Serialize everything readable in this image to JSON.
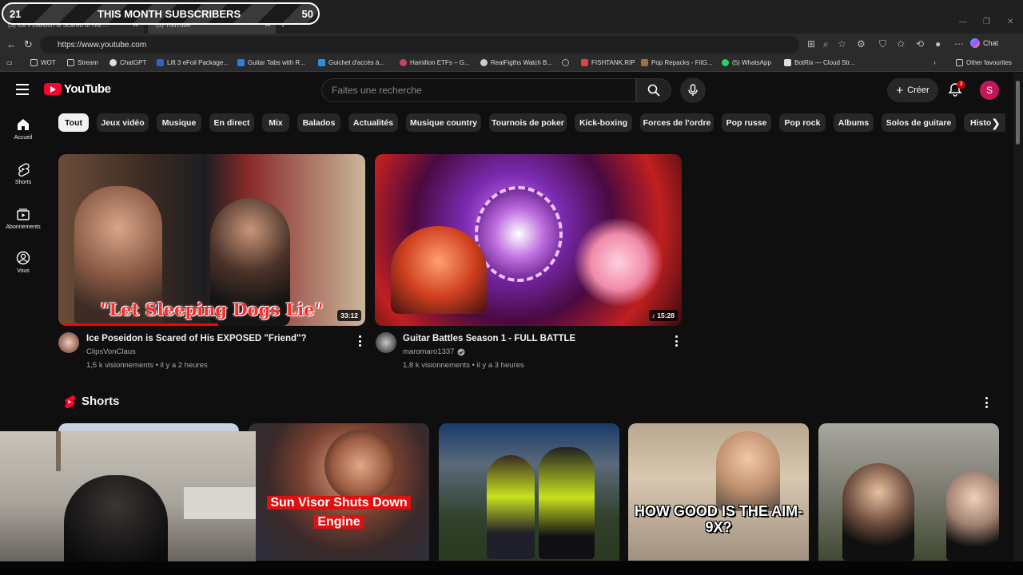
{
  "overlay": {
    "left_num": "21",
    "title": "THIS MONTH SUBSCRIBERS",
    "right_num": "50"
  },
  "browser": {
    "tabs": [
      {
        "label": "(3) Ice Poseidon is Scared of His ..."
      },
      {
        "label": "(3) YouTube"
      }
    ],
    "url": "https://www.youtube.com",
    "chat_label": "Chat",
    "bookmarks": [
      {
        "label": "WOT",
        "color": "#e0b040"
      },
      {
        "label": "Stream",
        "color": "#e0b040"
      },
      {
        "label": "ChatGPT",
        "color": "#dddddd"
      },
      {
        "label": "Lift 3 eFoil Package...",
        "color": "#3060d0"
      },
      {
        "label": "Guitar Tabs with R...",
        "color": "#2a7de1"
      },
      {
        "label": "Guichet d'accès à...",
        "color": "#2a8de1"
      },
      {
        "label": "Hamilton ETFs – G...",
        "color": "#d04060"
      },
      {
        "label": "RealFigths Watch B...",
        "color": "#cccccc"
      },
      {
        "label": "",
        "color": "#aaaaaa"
      },
      {
        "label": "FISHTANK.RIP",
        "color": "#e04040"
      },
      {
        "label": "Pop Repacks - FitG...",
        "color": "#a07040"
      },
      {
        "label": "(5) WhatsApp",
        "color": "#25d366"
      },
      {
        "label": "BotRix — Cloud Str...",
        "color": "#dddddd"
      }
    ],
    "other_favourites": "Other favourites"
  },
  "youtube": {
    "logo_text": "YouTube",
    "search_placeholder": "Faites une recherche",
    "create_label": "Créer",
    "notif_count": "3",
    "avatar_letter": "S",
    "sidebar": [
      {
        "label": "Accueil",
        "icon": "home-icon"
      },
      {
        "label": "Shorts",
        "icon": "shorts-icon"
      },
      {
        "label": "Abonnements",
        "icon": "subscriptions-icon"
      },
      {
        "label": "Vous",
        "icon": "you-icon"
      }
    ],
    "chips": [
      "Tout",
      "Jeux vidéo",
      "Musique",
      "En direct",
      "Mix",
      "Balados",
      "Actualités",
      "Musique country",
      "Tournois de poker",
      "Kick-boxing",
      "Forces de l'ordre",
      "Pop russe",
      "Pop rock",
      "Albums",
      "Solos de guitare",
      "Histo"
    ],
    "videos": [
      {
        "title": "Ice Poseidon is Scared of His EXPOSED \"Friend\"?",
        "channel": "ClipsVonClaus",
        "views": "1,5 k visionnements",
        "age": "il y a 2 heures",
        "duration": "33:12",
        "thumb_text": "\"Let Sleeping Dogs Lie\"",
        "verified": false
      },
      {
        "title": "Guitar Battles Season 1 - FULL BATTLE",
        "channel": "maromaro1337",
        "views": "1,8 k visionnements",
        "age": "il y a 3 heures",
        "duration": "15:28",
        "verified": true
      }
    ],
    "shorts_title": "Shorts",
    "shorts": [
      {
        "caption": ""
      },
      {
        "caption": "Sun Visor Shuts Down Engine"
      },
      {
        "caption": ""
      },
      {
        "caption": "HOW GOOD IS THE AIM-9X?"
      },
      {
        "caption": ""
      }
    ]
  }
}
